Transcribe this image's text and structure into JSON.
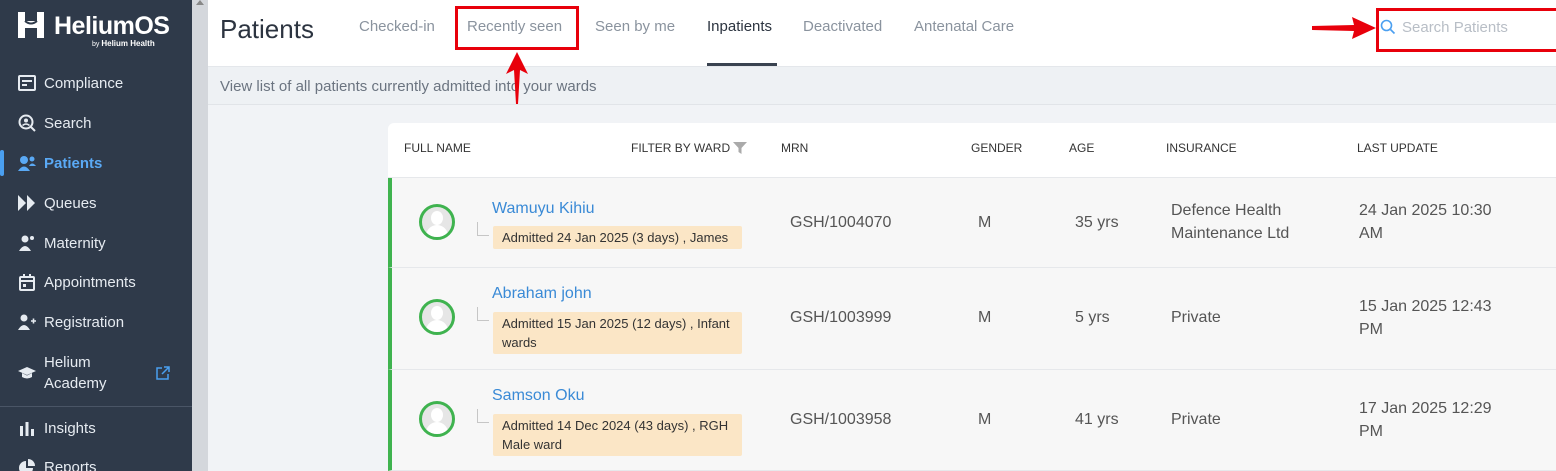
{
  "brand": {
    "title": "HeliumOS",
    "subtitle_by": "by",
    "subtitle_name": "Helium Health"
  },
  "sidebar": {
    "items": [
      {
        "label": "Compliance",
        "icon": "compliance-icon"
      },
      {
        "label": "Search",
        "icon": "search-icon"
      },
      {
        "label": "Patients",
        "icon": "patients-icon",
        "active": true
      },
      {
        "label": "Queues",
        "icon": "queues-icon"
      },
      {
        "label": "Maternity",
        "icon": "maternity-icon"
      },
      {
        "label": "Appointments",
        "icon": "calendar-icon"
      },
      {
        "label": "Registration",
        "icon": "add-user-icon"
      },
      {
        "label": "Helium Academy",
        "icon": "graduation-cap-icon",
        "external": true
      },
      {
        "label": "Insights",
        "icon": "bar-chart-icon"
      },
      {
        "label": "Reports",
        "icon": "pie-chart-icon"
      }
    ]
  },
  "header": {
    "title": "Patients",
    "tabs": [
      {
        "label": "Checked-in"
      },
      {
        "label": "Recently seen"
      },
      {
        "label": "Seen by me"
      },
      {
        "label": "Inpatients",
        "active": true
      },
      {
        "label": "Deactivated"
      },
      {
        "label": "Antenatal Care"
      }
    ],
    "search_placeholder": "Search Patients"
  },
  "subheader": {
    "text": "View list of all patients currently admitted into your wards"
  },
  "table": {
    "columns": {
      "full_name": "FULL NAME",
      "filter_ward": "FILTER BY WARD",
      "mrn": "MRN",
      "gender": "GENDER",
      "age": "AGE",
      "insurance": "INSURANCE",
      "last_update": "LAST UPDATE"
    },
    "rows": [
      {
        "name": "Wamuyu Kihiu",
        "admission": "Admitted 24 Jan 2025 (3 days) , James",
        "mrn": "GSH/1004070",
        "gender": "M",
        "age": "35 yrs",
        "insurance": "Defence Health Maintenance Ltd",
        "last_update": "24 Jan 2025 10:30 AM"
      },
      {
        "name": "Abraham john",
        "admission": "Admitted 15 Jan 2025 (12 days) , Infant wards",
        "mrn": "GSH/1003999",
        "gender": "M",
        "age": "5 yrs",
        "insurance": "Private",
        "last_update": "15 Jan 2025 12:43 PM"
      },
      {
        "name": "Samson Oku",
        "admission": "Admitted 14 Dec 2024 (43 days) , RGH Male ward",
        "mrn": "GSH/1003958",
        "gender": "M",
        "age": "41 yrs",
        "insurance": "Private",
        "last_update": "17 Jan 2025 12:29 PM"
      }
    ]
  },
  "colors": {
    "sidebar_bg": "#2f3a4a",
    "accent": "#3a8ad6",
    "active_row": "#3fb34f",
    "badge_bg": "#fbe6c6",
    "annotation": "#e8000b"
  }
}
